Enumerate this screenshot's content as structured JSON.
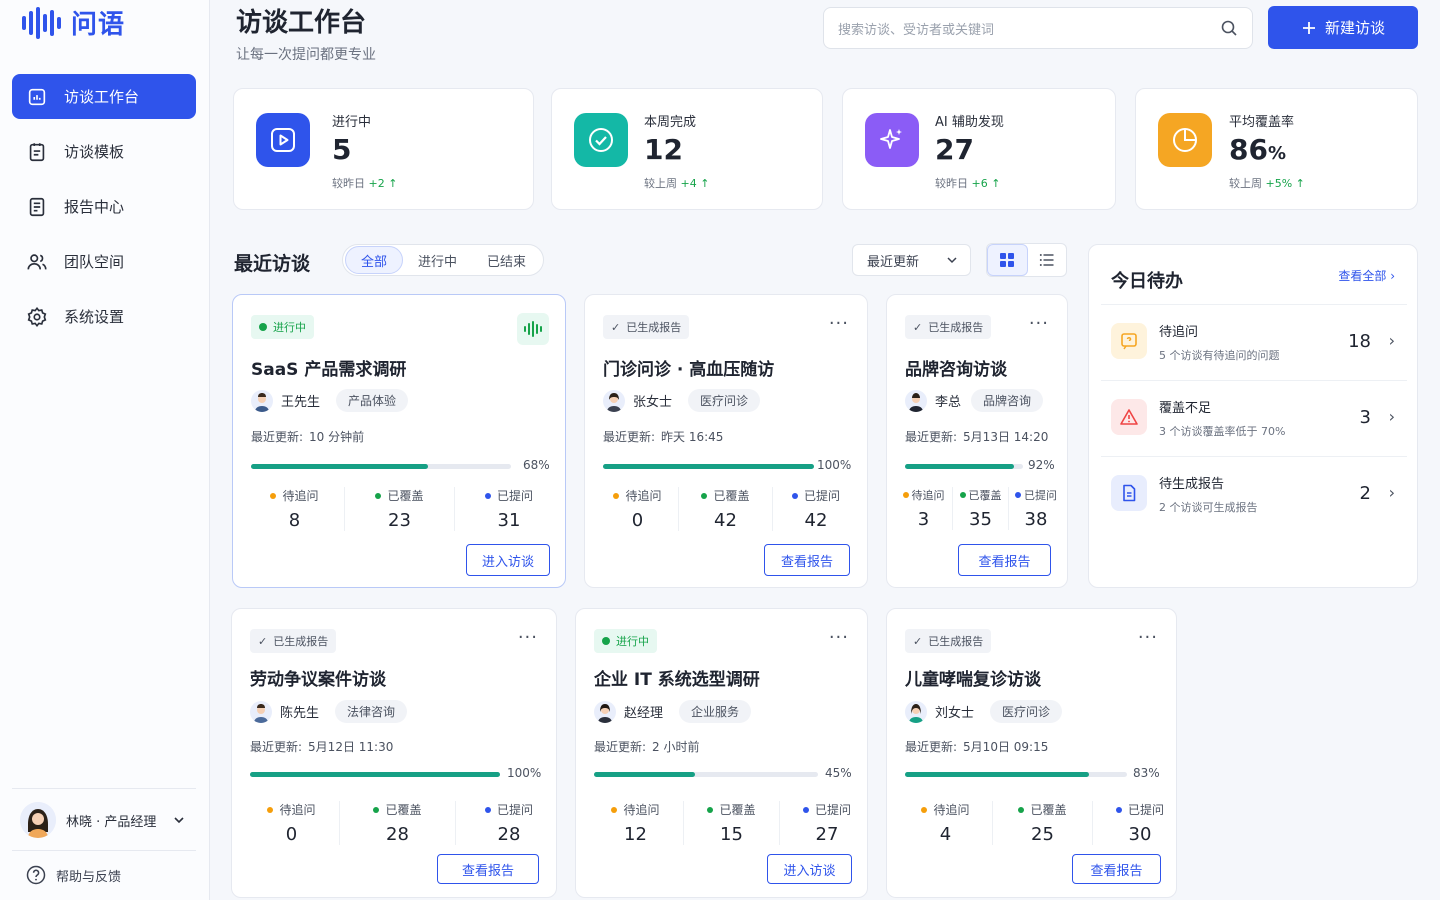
{
  "app": {
    "name": "问语"
  },
  "sidebar": {
    "items": [
      {
        "label": "访谈工作台",
        "icon": "workbench-icon",
        "active": true
      },
      {
        "label": "访谈模板",
        "icon": "template-icon",
        "active": false
      },
      {
        "label": "报告中心",
        "icon": "report-icon",
        "active": false
      },
      {
        "label": "团队空间",
        "icon": "team-icon",
        "active": false
      },
      {
        "label": "系统设置",
        "icon": "settings-icon",
        "active": false
      }
    ],
    "user": {
      "name": "林晓 · 产品经理"
    },
    "help_label": "帮助与反馈"
  },
  "header": {
    "title": "访谈工作台",
    "subtitle": "让每一次提问都更专业",
    "search_placeholder": "搜索访谈、受访者或关键词",
    "new_button": "新建访谈"
  },
  "stats": [
    {
      "label": "进行中",
      "value": "5",
      "unit": "",
      "compare": "较昨日",
      "delta": "+2",
      "color": "#2f54eb"
    },
    {
      "label": "本周完成",
      "value": "12",
      "unit": "",
      "compare": "较上周",
      "delta": "+4",
      "color": "#14b8a6"
    },
    {
      "label": "AI 辅助发现",
      "value": "27",
      "unit": "",
      "compare": "较昨日",
      "delta": "+6",
      "color": "#8b5cf6"
    },
    {
      "label": "平均覆盖率",
      "value": "86",
      "unit": "%",
      "compare": "较上周",
      "delta": "+5%",
      "color": "#f5a623"
    }
  ],
  "recent": {
    "title": "最近访谈",
    "filters": [
      "全部",
      "进行中",
      "已结束"
    ],
    "sort_label": "最近更新",
    "update_prefix": "最近更新:",
    "metric_labels": [
      "待追问",
      "已覆盖",
      "已提问"
    ]
  },
  "cards": [
    {
      "status": "进行中",
      "title": "SaaS 产品需求调研",
      "person": "王先生",
      "tag": "产品体验",
      "updated": "10 分钟前",
      "progress": 68,
      "progress_label": "68%",
      "metrics": [
        "8",
        "23",
        "31"
      ],
      "action": "进入访谈"
    },
    {
      "status": "已生成报告",
      "title": "门诊问诊 · 高血压随访",
      "person": "张女士",
      "tag": "医疗问诊",
      "updated": "昨天 16:45",
      "progress": 100,
      "progress_label": "100%",
      "metrics": [
        "0",
        "42",
        "42"
      ],
      "action": "查看报告"
    },
    {
      "status": "已生成报告",
      "title": "品牌咨询访谈",
      "person": "李总",
      "tag": "品牌咨询",
      "updated": "5月13日 14:20",
      "progress": 92,
      "progress_label": "92%",
      "metrics": [
        "3",
        "35",
        "38"
      ],
      "action": "查看报告"
    },
    {
      "status": "已生成报告",
      "title": "劳动争议案件访谈",
      "person": "陈先生",
      "tag": "法律咨询",
      "updated": "5月12日 11:30",
      "progress": 100,
      "progress_label": "100%",
      "metrics": [
        "0",
        "28",
        "28"
      ],
      "action": "查看报告"
    },
    {
      "status": "进行中",
      "title": "企业 IT 系统选型调研",
      "person": "赵经理",
      "tag": "企业服务",
      "updated": "2 小时前",
      "progress": 45,
      "progress_label": "45%",
      "metrics": [
        "12",
        "15",
        "27"
      ],
      "action": "进入访谈"
    },
    {
      "status": "已生成报告",
      "title": "儿童哮喘复诊访谈",
      "person": "刘女士",
      "tag": "医疗问诊",
      "updated": "5月10日 09:15",
      "progress": 83,
      "progress_label": "83%",
      "metrics": [
        "4",
        "25",
        "30"
      ],
      "action": "查看报告"
    }
  ],
  "todo": {
    "title": "今日待办",
    "view_all": "查看全部",
    "items": [
      {
        "name": "待追问",
        "desc": "5 个访谈有待追问的问题",
        "count": "18",
        "color": "#f5a623"
      },
      {
        "name": "覆盖不足",
        "desc": "3 个访谈覆盖率低于 70%",
        "count": "3",
        "color": "#ef4444"
      },
      {
        "name": "待生成报告",
        "desc": "2 个访谈可生成报告",
        "count": "2",
        "color": "#2f54eb"
      }
    ]
  }
}
